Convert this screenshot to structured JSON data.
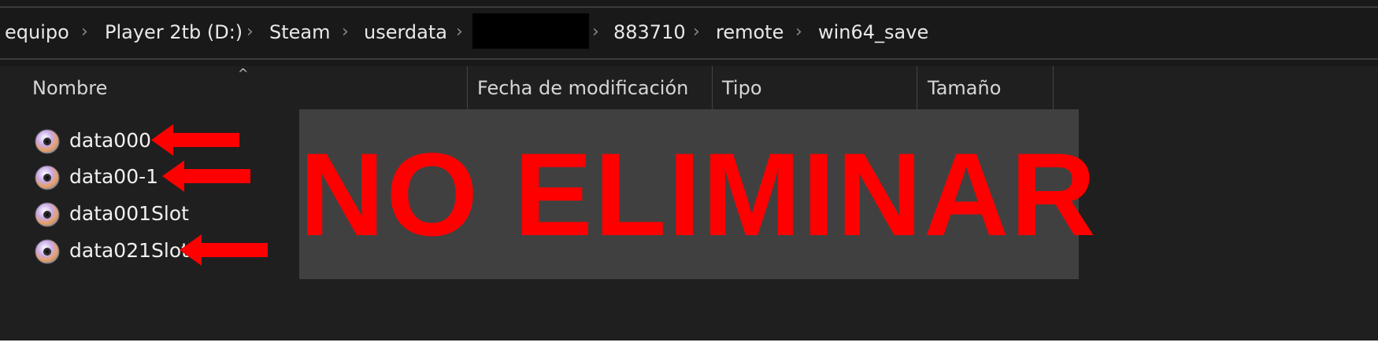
{
  "breadcrumb": {
    "items": [
      "equipo",
      "Player 2tb (D:)",
      "Steam",
      "userdata",
      "883710",
      "remote",
      "win64_save"
    ]
  },
  "columns": {
    "name": "Nombre",
    "modified": "Fecha de modificación",
    "type": "Tipo",
    "size": "Tamaño"
  },
  "files": [
    {
      "name": "data000",
      "icon": "disc-icon",
      "marked": true
    },
    {
      "name": "data00-1",
      "icon": "disc-icon",
      "marked": true
    },
    {
      "name": "data001Slot",
      "icon": "disc-icon",
      "marked": false
    },
    {
      "name": "data021Slot",
      "icon": "disc-icon",
      "marked": true
    }
  ],
  "overlay": {
    "text": "NO ELIMINAR"
  },
  "colors": {
    "background": "#1f1f1f",
    "overlay_bg": "#404040",
    "warning": "#ff0000"
  },
  "icons": {
    "sort": "chevron-up-icon",
    "separator": "chevron-right-icon",
    "arrow": "red-left-arrow-icon"
  }
}
